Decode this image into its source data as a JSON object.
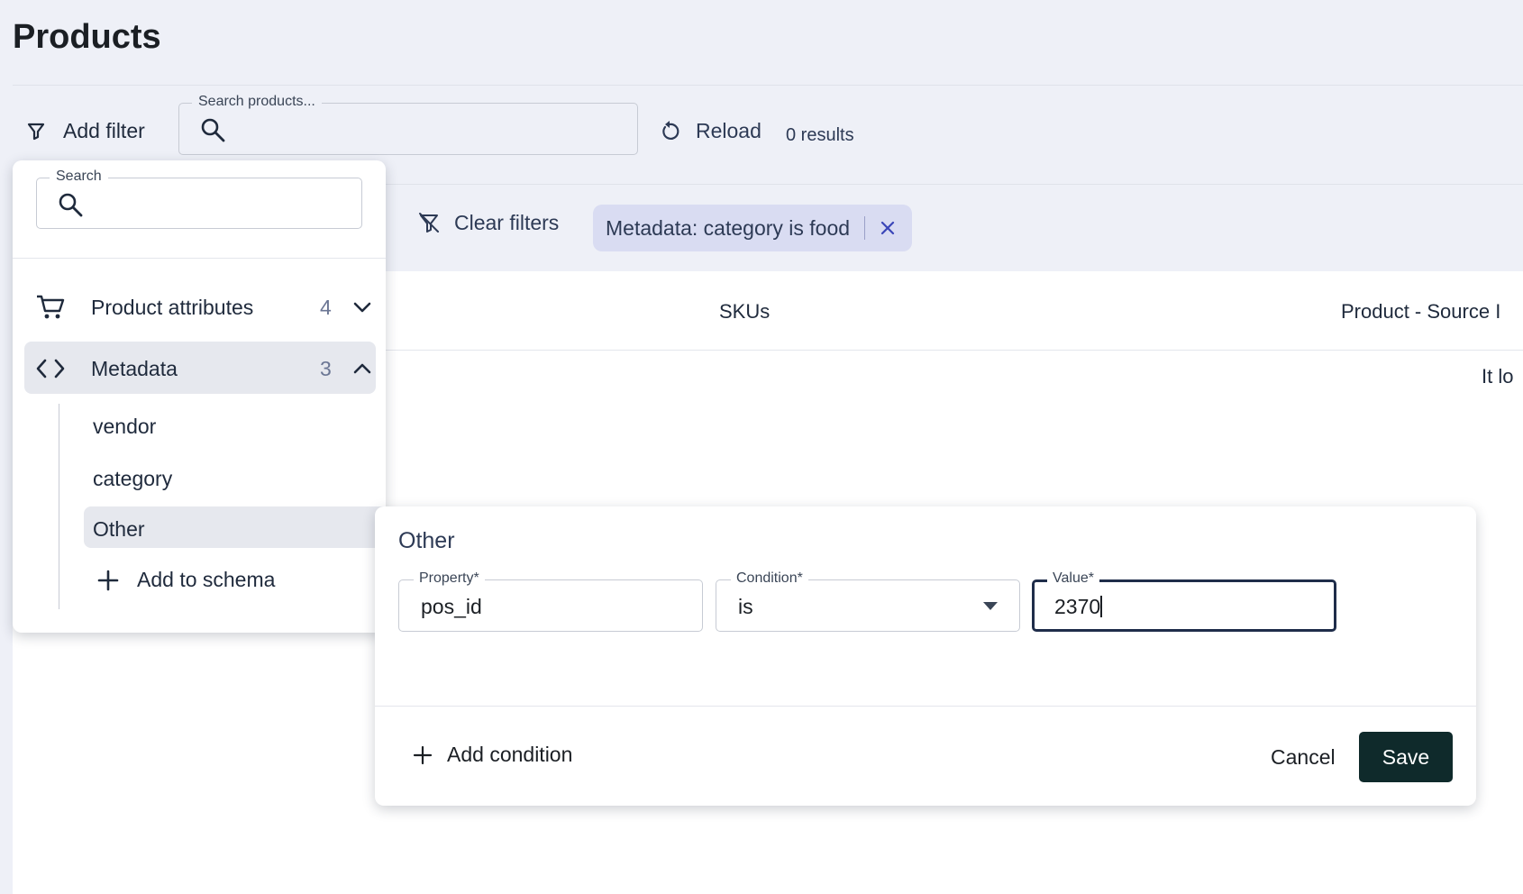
{
  "page": {
    "title": "Products"
  },
  "toolbar": {
    "add_filter_label": "Add filter",
    "search_label": "Search products...",
    "reload_label": "Reload",
    "results_text": "0 results"
  },
  "filters": {
    "clear_label": "Clear filters",
    "active_chip": "Metadata: category is food"
  },
  "table": {
    "columns": [
      "SKUs",
      "Product - Source I"
    ],
    "empty_message": "It lo"
  },
  "filter_panel": {
    "search_label": "Search",
    "groups": [
      {
        "label": "Product attributes",
        "count": "4",
        "icon": "cart-icon",
        "expanded": false
      },
      {
        "label": "Metadata",
        "count": "3",
        "icon": "code-icon",
        "expanded": true
      }
    ],
    "metadata_items": [
      "vendor",
      "category",
      "Other"
    ],
    "selected_item": "Other",
    "add_schema_label": "Add to schema"
  },
  "condition_dialog": {
    "title": "Other",
    "property_label": "Property*",
    "property_value": "pos_id",
    "condition_label": "Condition*",
    "condition_value": "is",
    "value_label": "Value*",
    "value_value": "2370",
    "add_condition_label": "Add condition",
    "cancel_label": "Cancel",
    "save_label": "Save"
  },
  "colors": {
    "background": "#eef0f7",
    "chip_background": "#d9dcf2",
    "save_button": "#0f2a2b",
    "selected_item": "#e6e8ee",
    "focused_border": "#1f2d4a"
  }
}
